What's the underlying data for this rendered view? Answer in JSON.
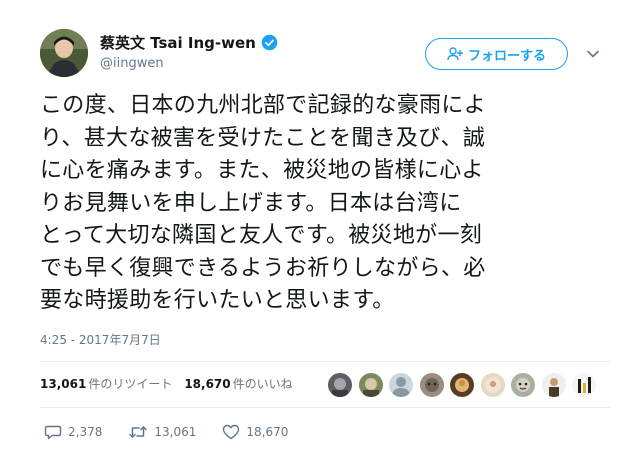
{
  "author": {
    "display_name": "蔡英文 Tsai Ing-wen",
    "handle": "@iingwen",
    "verified": true
  },
  "follow_button": {
    "label": "フォローする",
    "icon": "add-user-icon"
  },
  "tweet": {
    "text": "この度、日本の九州北部で記録的な豪雨によ\nり、甚大な被害を受けたことを聞き及び、誠\nに心を痛みます。また、被災地の皆様に心よ\nりお見舞いを申し上げます。日本は台湾に\nとって大切な隣国と友人です。被災地が一刻\nでも早く復興できるようお祈りしながら、必\n要な時援助を行いたいと思います。",
    "timestamp": "4:25 - 2017年7月7日"
  },
  "stats": {
    "retweet_count": "13,061",
    "retweet_label": "件のリツイート",
    "like_count": "18,670",
    "like_label": "件のいいね"
  },
  "likers": [
    "avatar-1",
    "avatar-2",
    "avatar-3",
    "avatar-4",
    "avatar-5",
    "avatar-6",
    "avatar-7",
    "avatar-8",
    "avatar-9"
  ],
  "actions": {
    "reply_count": "2,378",
    "retweet_count": "13,061",
    "like_count": "18,670"
  },
  "colors": {
    "accent": "#1da1f2",
    "verified": "#1da1f2",
    "muted": "#657786",
    "text": "#14171a"
  }
}
